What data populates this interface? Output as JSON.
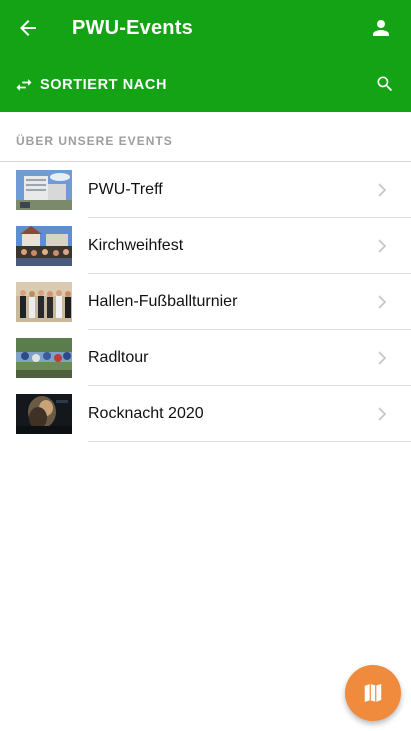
{
  "appbar": {
    "title": "PWU-Events",
    "back_icon": "arrow-back-icon",
    "profile_icon": "person-icon",
    "sort_label": "SORTIERT NACH",
    "sort_icon": "swap-arrows-icon",
    "search_icon": "search-icon",
    "color": "#15a316"
  },
  "section": {
    "header": "ÜBER UNSERE EVENTS"
  },
  "events": [
    {
      "label": "PWU-Treff",
      "thumbnail": "building-photo"
    },
    {
      "label": "Kirchweihfest",
      "thumbnail": "festival-crowd-photo"
    },
    {
      "label": "Hallen-Fußballturnier",
      "thumbnail": "group-photo"
    },
    {
      "label": "Radltour",
      "thumbnail": "cyclists-photo"
    },
    {
      "label": "Rocknacht 2020",
      "thumbnail": "concert-photo"
    }
  ],
  "fab": {
    "icon": "map-icon",
    "color": "#f08a3c"
  }
}
